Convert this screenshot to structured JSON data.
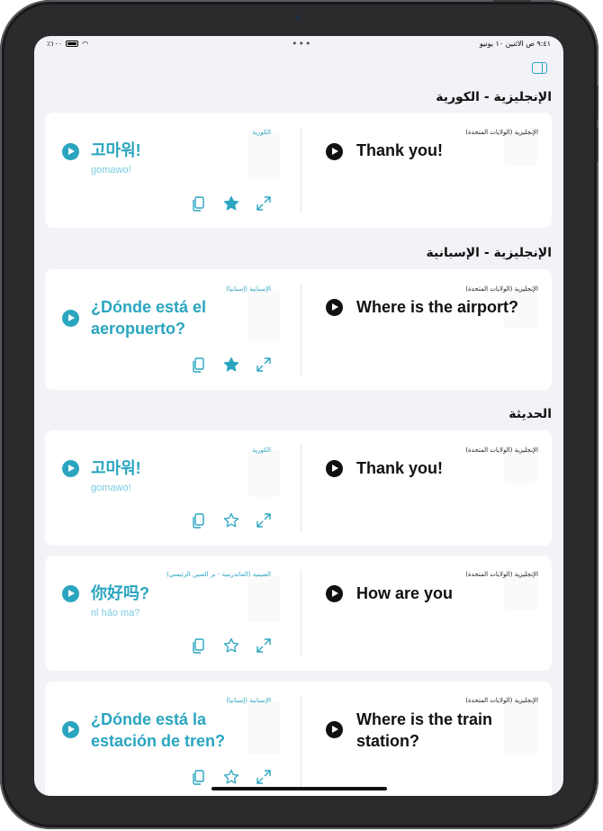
{
  "status_bar": {
    "battery": "٪١٠٠",
    "datetime": "٩:٤١ ص   الاثنين ١٠ يونيو"
  },
  "sections": {
    "korean": {
      "title": "الإنجليزية - الكورية"
    },
    "spanish": {
      "title": "الإنجليزية - الإسبانية"
    },
    "recent": {
      "title": "الحديثة"
    }
  },
  "cards": [
    {
      "source_lang": "الكورية",
      "source_text": "고마워!",
      "transliteration": "gomawo!",
      "target_lang": "الإنجليزية (الولايات المتحدة)",
      "target_text": "Thank you!",
      "favorited": true
    },
    {
      "source_lang": "الإسبانية (إسبانيا)",
      "source_text": "¿Dónde está el aeropuerto?",
      "transliteration": "",
      "target_lang": "الإنجليزية (الولايات المتحدة)",
      "target_text": "Where is the airport?",
      "favorited": true
    },
    {
      "source_lang": "الكورية",
      "source_text": "고마워!",
      "transliteration": "gomawo!",
      "target_lang": "الإنجليزية (الولايات المتحدة)",
      "target_text": "Thank you!",
      "favorited": false
    },
    {
      "source_lang": "الصينية (الماندرينية - بر الصين الرئيسي)",
      "source_text": "你好吗?",
      "transliteration": "nǐ hǎo ma?",
      "target_lang": "الإنجليزية (الولايات المتحدة)",
      "target_text": "How are you",
      "favorited": false
    },
    {
      "source_lang": "الإسبانية (إسبانيا)",
      "source_text": "¿Dónde está la estación de tren?",
      "transliteration": "",
      "target_lang": "الإنجليزية (الولايات المتحدة)",
      "target_text": "Where is the train station?",
      "favorited": false
    }
  ],
  "icons": {
    "play": "play-icon",
    "copy": "copy-icon",
    "favorite": "star-icon",
    "fullscreen": "expand-icon",
    "sidebar": "sidebar-icon"
  },
  "colors": {
    "accent": "#2aa5c0",
    "background": "#f2f2f7"
  }
}
